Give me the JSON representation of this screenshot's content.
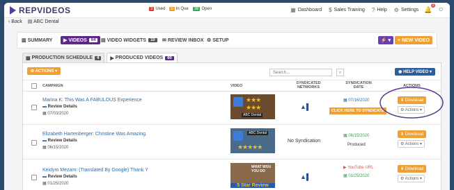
{
  "app": {
    "logo": "REPVIDEOS"
  },
  "status": [
    {
      "count": "3",
      "label": "Used",
      "color": "#e0392b"
    },
    {
      "count": "5",
      "label": "In Que",
      "color": "#f0a030"
    },
    {
      "count": "38",
      "label": "Open",
      "color": "#3aa655"
    }
  ],
  "topnav": {
    "dashboard": "Dashboard",
    "sales": "Sales Training",
    "help": "Help",
    "settings": "Settings",
    "notif_count": "2"
  },
  "back": {
    "label": "Back",
    "crumb": "ABC Dental"
  },
  "tabs": [
    {
      "label": "SUMMARY",
      "count": ""
    },
    {
      "label": "VIDEOS",
      "count": "64"
    },
    {
      "label": "VIDEO WIDGETS",
      "count": "10"
    },
    {
      "label": "REVIEW INBOX",
      "count": ""
    },
    {
      "label": "SETUP",
      "count": ""
    }
  ],
  "buttons": {
    "bolt": "⚡ ▾",
    "new_video": "+ NEW VIDEO"
  },
  "subtabs": [
    {
      "label": "PRODUCTION SCHEDULE",
      "count": "4"
    },
    {
      "label": "PRODUCED VIDEOS",
      "count": "60"
    }
  ],
  "toolbar": {
    "actions": "✿ ACTIONS ▾",
    "search_placeholder": "Search...",
    "help_video": "HELP VIDEO ▾"
  },
  "columns": {
    "campaign": "CAMPAIGN",
    "video": "VIDEO",
    "networks": "SYNDICATED NETWORKS",
    "sync_date": "SYNDICATION DATE",
    "actions": "ACTIONS"
  },
  "rows": [
    {
      "title": "Marina K: This Was A FABULOUS Experience",
      "review": "Review Details",
      "date": "07/03/2020",
      "thumb_label": "ABC Dental",
      "networks_icon": "network-icon",
      "sync_date": "07/16/2020",
      "sync_link": "CLICK HERE TO SYNDICATE",
      "download": "Download",
      "actions": "Actions ▾"
    },
    {
      "title": "Elizabeth Hartenberger: Christine Was Amazing.",
      "review": "Review Details",
      "date": "06/15/2020",
      "thumb_label": "ABC Dental",
      "networks_text": "No Syndication",
      "sync_date": "06/15/2020",
      "sync_status": "Produced",
      "download": "Download",
      "actions": "Actions ▾"
    },
    {
      "title": "Keidym Mezam: (Translated By Google) Thank Y",
      "review": "Review Details",
      "date": "01/25/2020",
      "thumb_label": "5 Star Review",
      "thumb_top": "WHAT WOU YOU DO",
      "networks_icon": "network-icon",
      "yt": "YouTube URL",
      "sync_date": "01/25/2020",
      "download": "Download",
      "actions": "Actions ▾"
    }
  ]
}
